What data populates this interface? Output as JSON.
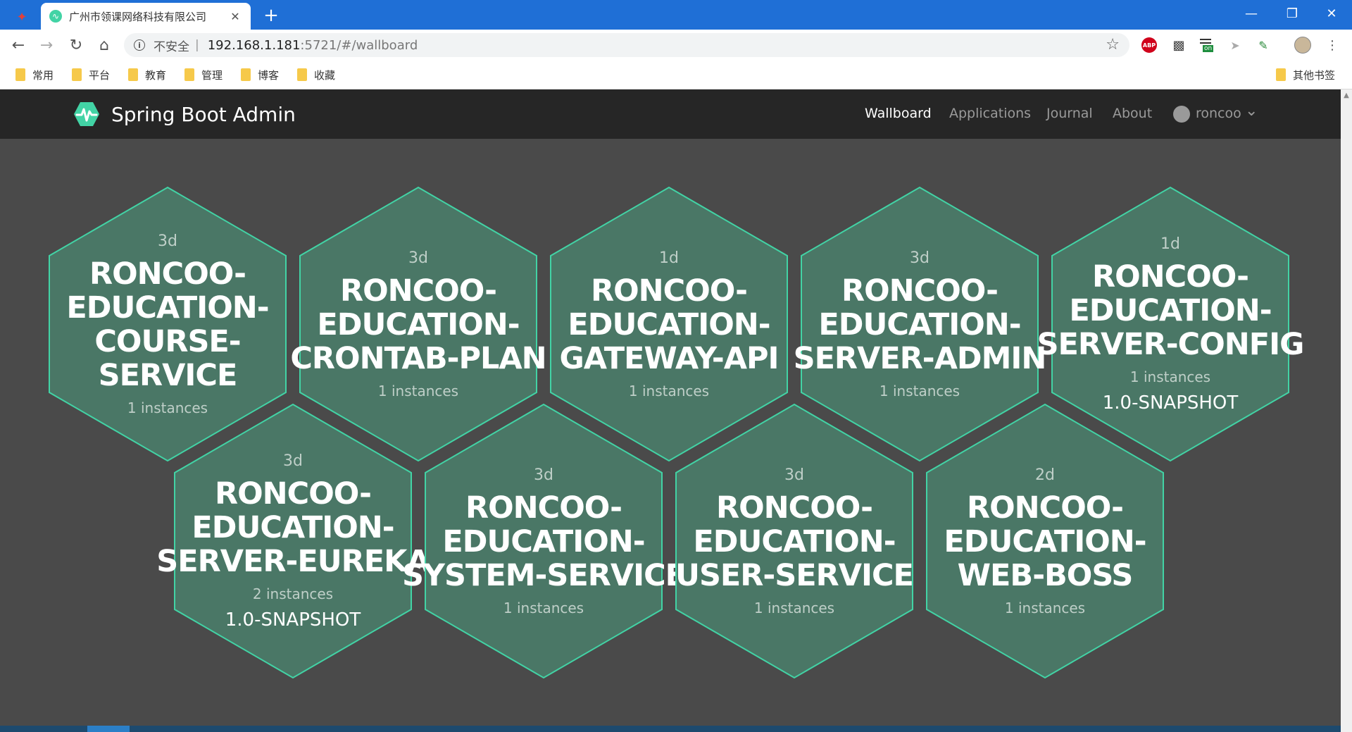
{
  "browser": {
    "tab_title": "广州市领课网络科技有限公司",
    "url_insecure_label": "不安全",
    "url_separator": "|",
    "url_host": "192.168.1.181",
    "url_rest": ":5721/#/wallboard",
    "bookmarks": [
      "常用",
      "平台",
      "教育",
      "管理",
      "博客",
      "收藏"
    ],
    "other_bookmarks": "其他书签",
    "extensions": {
      "abp": "ABP",
      "on": "on"
    }
  },
  "app": {
    "brand": "Spring Boot Admin",
    "nav": [
      "Wallboard",
      "Applications",
      "Journal",
      "About"
    ],
    "user": "roncoo"
  },
  "wallboard": {
    "applications": [
      {
        "uptime": "3d",
        "name_lines": [
          "RONCOO-",
          "EDUCATION-",
          "COURSE-",
          "SERVICE"
        ],
        "instances": "1 instances",
        "version": ""
      },
      {
        "uptime": "3d",
        "name_lines": [
          "RONCOO-",
          "EDUCATION-",
          "CRONTAB-PLAN"
        ],
        "instances": "1 instances",
        "version": ""
      },
      {
        "uptime": "1d",
        "name_lines": [
          "RONCOO-",
          "EDUCATION-",
          "GATEWAY-API"
        ],
        "instances": "1 instances",
        "version": ""
      },
      {
        "uptime": "3d",
        "name_lines": [
          "RONCOO-",
          "EDUCATION-",
          "SERVER-ADMIN"
        ],
        "instances": "1 instances",
        "version": ""
      },
      {
        "uptime": "1d",
        "name_lines": [
          "RONCOO-",
          "EDUCATION-",
          "SERVER-CONFIG"
        ],
        "instances": "1 instances",
        "version": "1.0-SNAPSHOT"
      },
      {
        "uptime": "3d",
        "name_lines": [
          "RONCOO-",
          "EDUCATION-",
          "SERVER-EUREKA"
        ],
        "instances": "2 instances",
        "version": "1.0-SNAPSHOT"
      },
      {
        "uptime": "3d",
        "name_lines": [
          "RONCOO-",
          "EDUCATION-",
          "SYSTEM-SERVICE"
        ],
        "instances": "1 instances",
        "version": ""
      },
      {
        "uptime": "3d",
        "name_lines": [
          "RONCOO-",
          "EDUCATION-",
          "USER-SERVICE"
        ],
        "instances": "1 instances",
        "version": ""
      },
      {
        "uptime": "2d",
        "name_lines": [
          "RONCOO-",
          "EDUCATION-",
          "WEB-BOSS"
        ],
        "instances": "1 instances",
        "version": ""
      }
    ]
  },
  "colors": {
    "hex_fill": "#4a7766",
    "hex_stroke": "#42d3a5",
    "page_bg": "#4a4a4a",
    "navbar_bg": "#262626"
  }
}
